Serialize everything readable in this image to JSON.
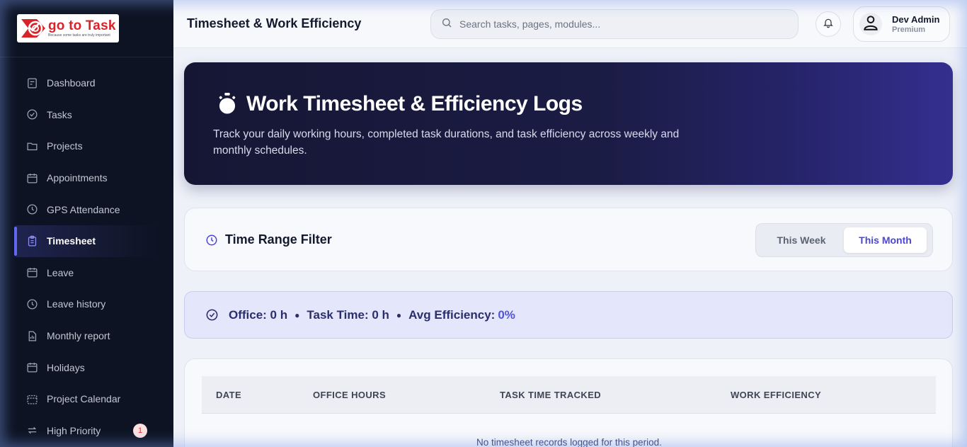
{
  "brand": {
    "name": "go to Task",
    "tagline": "Because some tasks are truly important"
  },
  "sidebar": {
    "items": [
      {
        "label": "Dashboard",
        "icon": "dashboard-icon"
      },
      {
        "label": "Tasks",
        "icon": "check-circle-icon"
      },
      {
        "label": "Projects",
        "icon": "folder-icon"
      },
      {
        "label": "Appointments",
        "icon": "calendar-icon"
      },
      {
        "label": "GPS Attendance",
        "icon": "clock-icon"
      },
      {
        "label": "Timesheet",
        "icon": "clipboard-icon",
        "active": true
      },
      {
        "label": "Leave",
        "icon": "calendar-icon"
      },
      {
        "label": "Leave history",
        "icon": "clock-icon"
      },
      {
        "label": "Monthly report",
        "icon": "report-icon"
      },
      {
        "label": "Holidays",
        "icon": "calendar-icon"
      },
      {
        "label": "Project Calendar",
        "icon": "dashed-calendar-icon"
      },
      {
        "label": "High Priority",
        "icon": "arrows-icon",
        "badge": "1"
      }
    ]
  },
  "header": {
    "title": "Timesheet & Work Efficiency",
    "search_placeholder": "Search tasks, pages, modules...",
    "user_name": "Dev Admin",
    "user_plan": "Premium"
  },
  "hero": {
    "title": "Work Timesheet & Efficiency Logs",
    "description": "Track your daily working hours, completed task durations, and task efficiency across weekly and monthly schedules."
  },
  "filter": {
    "title": "Time Range Filter",
    "options": [
      "This Week",
      "This Month"
    ],
    "selected": "This Month"
  },
  "summary": {
    "office": "Office: 0 h",
    "task_time": "Task Time: 0 h",
    "avg_label": "Avg Efficiency:",
    "avg_value": "0%",
    "separator": "●"
  },
  "table": {
    "columns": [
      "DATE",
      "OFFICE HOURS",
      "TASK TIME TRACKED",
      "WORK EFFICIENCY"
    ],
    "empty_text": "No timesheet records logged for this period."
  },
  "colors": {
    "sidebar_bg": "#0d1322",
    "accent": "#6366f1",
    "hero_start": "#161634",
    "hero_end": "#342f8f"
  }
}
